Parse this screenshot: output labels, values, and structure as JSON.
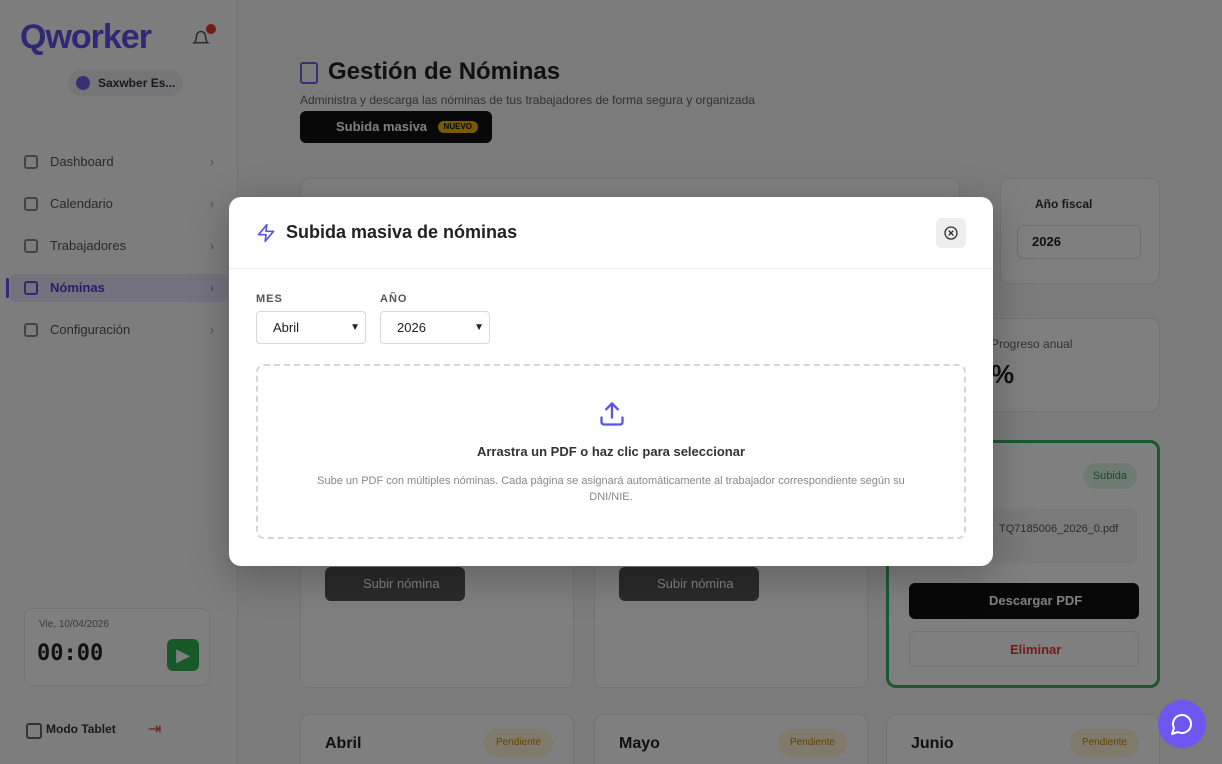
{
  "sidebar": {
    "logo": "Qworker",
    "company": "Saxwber Es...",
    "items": [
      {
        "label": "Dashboard",
        "chevron": "›"
      },
      {
        "label": "Calendario",
        "chevron": "›"
      },
      {
        "label": "Trabajadores",
        "chevron": "›"
      },
      {
        "label": "Nóminas",
        "chevron": "›"
      },
      {
        "label": "Configuración",
        "chevron": "›"
      }
    ],
    "clock": {
      "label": "Vie, 10/04/2026",
      "time": "00:00",
      "play": "▶"
    },
    "mode": "Modo Tablet",
    "logout_icon": "logout-icon"
  },
  "main": {
    "title": "Gestión de Nóminas",
    "subtitle": "Administra y descarga las nóminas de tus trabajadores de forma segura y organizada",
    "bulk_button": {
      "label": "Subida masiva",
      "badge": "NUEVO"
    },
    "year_card": {
      "label": "Año fiscal",
      "value": "2026"
    },
    "progress_card": {
      "label": "Progreso anual",
      "value": "%"
    },
    "upload_label": "Subir nómina",
    "done_card": {
      "pill": "Subida",
      "file": "TQ7185006_2026_0.pdf",
      "download": "Descargar PDF",
      "delete": "Eliminar"
    },
    "row2": [
      {
        "month": "Abril",
        "pill": "Pendiente"
      },
      {
        "month": "Mayo",
        "pill": "Pendiente"
      },
      {
        "month": "Junio",
        "pill": "Pendiente"
      }
    ]
  },
  "modal": {
    "title": "Subida masiva de nóminas",
    "month": {
      "label": "MES",
      "value": "Abril"
    },
    "year": {
      "label": "AÑO",
      "value": "2026"
    },
    "dropzone": {
      "title": "Arrastra un PDF o haz clic para seleccionar",
      "subtitle": "Sube un PDF con múltiples nóminas. Cada página se asignará automáticamente al trabajador correspondiente según su DNI/NIE."
    }
  },
  "colors": {
    "accent": "#5b52e8",
    "overlay": "rgba(0,0,0,0.5)",
    "chat": "#6e56f0"
  }
}
